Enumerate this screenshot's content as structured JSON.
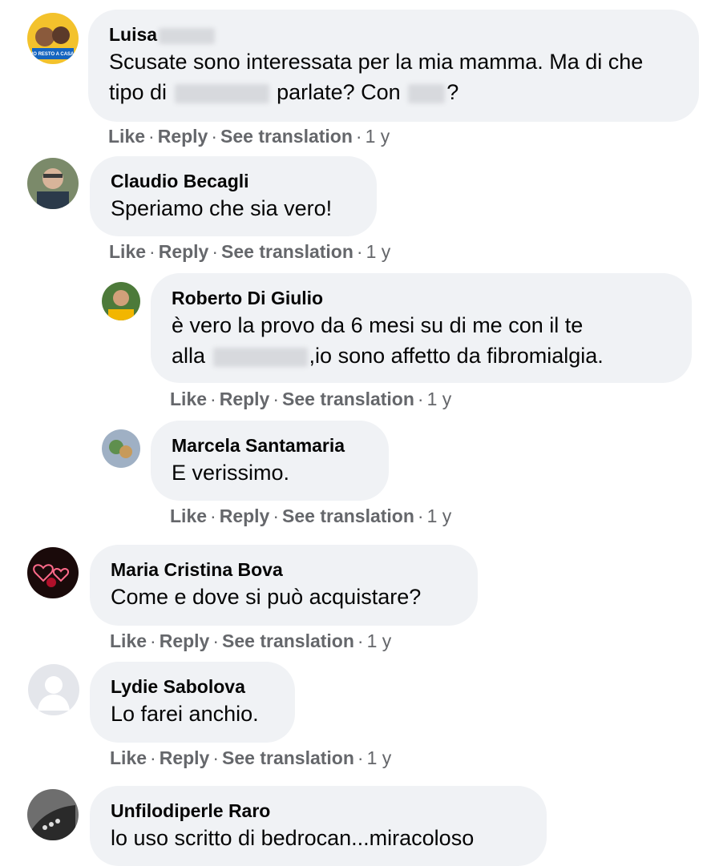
{
  "comments": [
    {
      "author": "Luisa",
      "text_part1": "Scusate sono interessata per la mia mamma. Ma di che tipo di",
      "text_part2": "parlate? Con",
      "text_part3": "?",
      "like": "Like",
      "reply": "Reply",
      "translate": "See translation",
      "time": "1 y",
      "avatar_badge": "IO RESTO A CASA"
    },
    {
      "author": "Claudio Becagli",
      "text": "Speriamo che sia vero!",
      "like": "Like",
      "reply": "Reply",
      "translate": "See translation",
      "time": "1 y"
    },
    {
      "author": "Roberto Di Giulio",
      "text_line1": "è vero la provo da 6 mesi su di me con il te",
      "text_line2_pre": "alla",
      "text_line2_post": ",io sono affetto da fibromialgia.",
      "like": "Like",
      "reply": "Reply",
      "translate": "See translation",
      "time": "1 y"
    },
    {
      "author": "Marcela Santamaria",
      "text": "E verissimo.",
      "like": "Like",
      "reply": "Reply",
      "translate": "See translation",
      "time": "1 y"
    },
    {
      "author": "Maria Cristina Bova",
      "text": "Come e dove si può acquistare?",
      "like": "Like",
      "reply": "Reply",
      "translate": "See translation",
      "time": "1 y"
    },
    {
      "author": "Lydie Sabolova",
      "text": "Lo farei anchio.",
      "like": "Like",
      "reply": "Reply",
      "translate": "See translation",
      "time": "1 y"
    },
    {
      "author": "Unfilodiperle Raro",
      "text": "lo uso scritto di bedrocan...miracoloso"
    }
  ],
  "separator": "·",
  "colors": {
    "bubble": "#f0f2f5",
    "action_text": "#65676b",
    "author_text": "#050505"
  }
}
